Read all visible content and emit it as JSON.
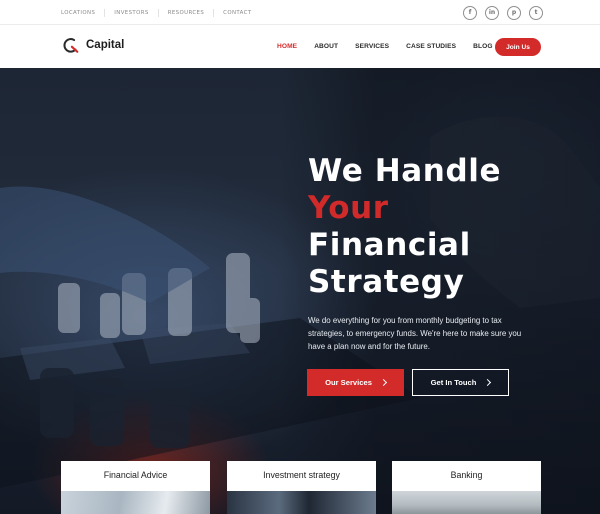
{
  "topbar": {
    "links": [
      "LOCATIONS",
      "INVESTORS",
      "RESOURCES",
      "CONTACT"
    ],
    "socials": [
      {
        "icon": "facebook-icon",
        "glyph": "f"
      },
      {
        "icon": "linkedin-icon",
        "glyph": "in"
      },
      {
        "icon": "pinterest-icon",
        "glyph": "p"
      },
      {
        "icon": "twitter-icon",
        "glyph": "t"
      }
    ]
  },
  "nav": {
    "logo_text": "Capital",
    "items": [
      "HOME",
      "ABOUT",
      "SERVICES",
      "CASE STUDIES",
      "BLOG"
    ],
    "active": "HOME",
    "join_label": "Join Us"
  },
  "hero": {
    "title_line1": "We Handle",
    "title_line2": "Your",
    "title_line3": "Financial",
    "title_line4": "Strategy",
    "description": "We do everything for you from monthly budgeting to tax strategies, to emergency funds. We're here to make sure you have a plan now and for the future.",
    "primary_button": "Our Services",
    "secondary_button": "Get In Touch"
  },
  "cards": [
    {
      "title": "Financial Advice"
    },
    {
      "title": "Investment strategy"
    },
    {
      "title": "Banking"
    }
  ],
  "colors": {
    "accent": "#d32a2a",
    "text_dark": "#1d1d1d",
    "hero_bg": "#1d2634"
  }
}
